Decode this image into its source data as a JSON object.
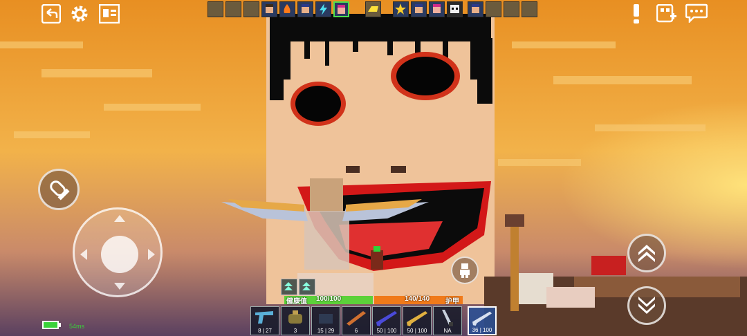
{
  "hotbar_top": {
    "slots": [
      "empty",
      "empty",
      "face",
      "fire",
      "face-blue",
      "lightning",
      "face-pink",
      "gold",
      "star",
      "face",
      "face-pink",
      "skull",
      "face",
      "empty",
      "empty",
      "empty",
      "empty"
    ]
  },
  "health": {
    "label": "健康值",
    "value": "100/100",
    "fraction": 1.0
  },
  "armor": {
    "label": "护甲",
    "value": "140/140",
    "fraction": 1.0
  },
  "weapons": [
    {
      "icon": "pistol-icon",
      "ammo": "8 | 27"
    },
    {
      "icon": "grenade-icon",
      "ammo": "3"
    },
    {
      "icon": "ammo-box-icon",
      "ammo": "15 | 29"
    },
    {
      "icon": "rocket-launcher-icon",
      "ammo": "6"
    },
    {
      "icon": "rifle-icon",
      "ammo": "50 | 100"
    },
    {
      "icon": "gold-rifle-icon",
      "ammo": "50 | 100"
    },
    {
      "icon": "knife-icon",
      "ammo": "NA"
    },
    {
      "icon": "assault-rifle-icon",
      "ammo": "36 | 100"
    }
  ],
  "selected_weapon": 7,
  "ping": "54ms",
  "colors": {
    "health": "#5cd13a",
    "armor": "#f07a1a",
    "sky_top": "#e89a2a",
    "sky_bottom": "#6b4a5a"
  }
}
